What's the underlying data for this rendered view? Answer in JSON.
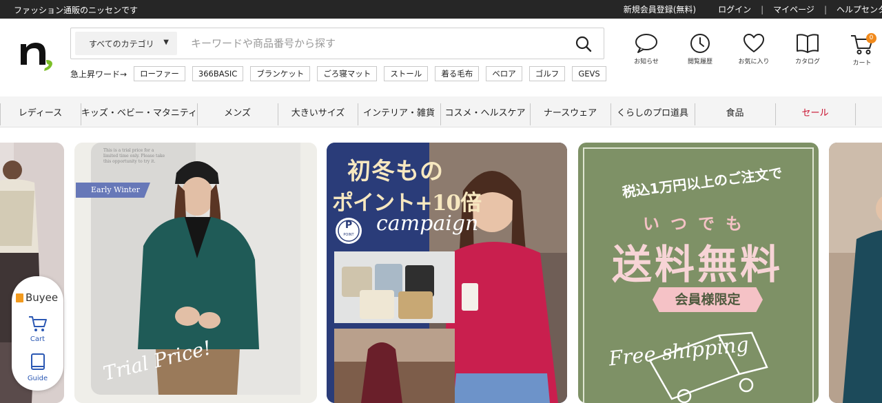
{
  "topbar": {
    "tagline": "ファッション通販のニッセンです",
    "links": [
      {
        "label": "新規会員登録(無料)"
      },
      {
        "label": "ログイン"
      },
      {
        "label": "マイページ"
      },
      {
        "label": "ヘルプセンター"
      }
    ]
  },
  "header": {
    "category_select": "すべてのカテゴリ",
    "category_arrow": "▼",
    "search_placeholder": "キーワードや商品番号から探す",
    "trend_label": "急上昇ワード→",
    "trend_words": [
      "ローファー",
      "366BASIC",
      "ブランケット",
      "ごろ寝マット",
      "ストール",
      "着る毛布",
      "ベロア",
      "ゴルフ",
      "GEVS"
    ],
    "icons": [
      {
        "icon": "chat-bubble-icon",
        "label": "お知らせ"
      },
      {
        "icon": "clock-icon",
        "label": "閲覧履歴"
      },
      {
        "icon": "heart-icon",
        "label": "お気に入り"
      },
      {
        "icon": "book-icon",
        "label": "カタログ"
      },
      {
        "icon": "cart-icon",
        "label": "カート",
        "badge": "0"
      }
    ]
  },
  "nav": {
    "categories": [
      "レディース",
      "キッズ・ベビー・マタニティ",
      "メンズ",
      "大きいサイズ",
      "インテリア・雑貨",
      "コスメ・ヘルスケア",
      "ナースウェア",
      "くらしのプロ道具",
      "食品",
      "セール"
    ],
    "sale_color": "#c8102e"
  },
  "banners": {
    "b1": {
      "small_text": "This is a trial price for a limited time only. Please take this opportunity to try it.",
      "tag": "Early Winter",
      "script": "Trial Price!"
    },
    "b2": {
      "title_line1": "初冬もの",
      "title_line2": "ポイント+10倍",
      "script": "campaign",
      "badge_letter": "P",
      "badge_text": "POINT"
    },
    "b3": {
      "line1": "税込1万円以上のご注文で",
      "line2": "いつでも",
      "headline": "送料無料",
      "ribbon": "会員様限定",
      "script": "Free shipping"
    }
  },
  "buyee": {
    "brand": "Buyee",
    "cart_label": "Cart",
    "guide_label": "Guide"
  },
  "colors": {
    "topbar_bg": "#262626",
    "nav_bg": "#f4f4f4",
    "campaign_blue": "#2a3c79",
    "shipping_green": "#7e9166",
    "shipping_pink": "#f5c2c6",
    "buyee_orange": "#f29a1e"
  }
}
